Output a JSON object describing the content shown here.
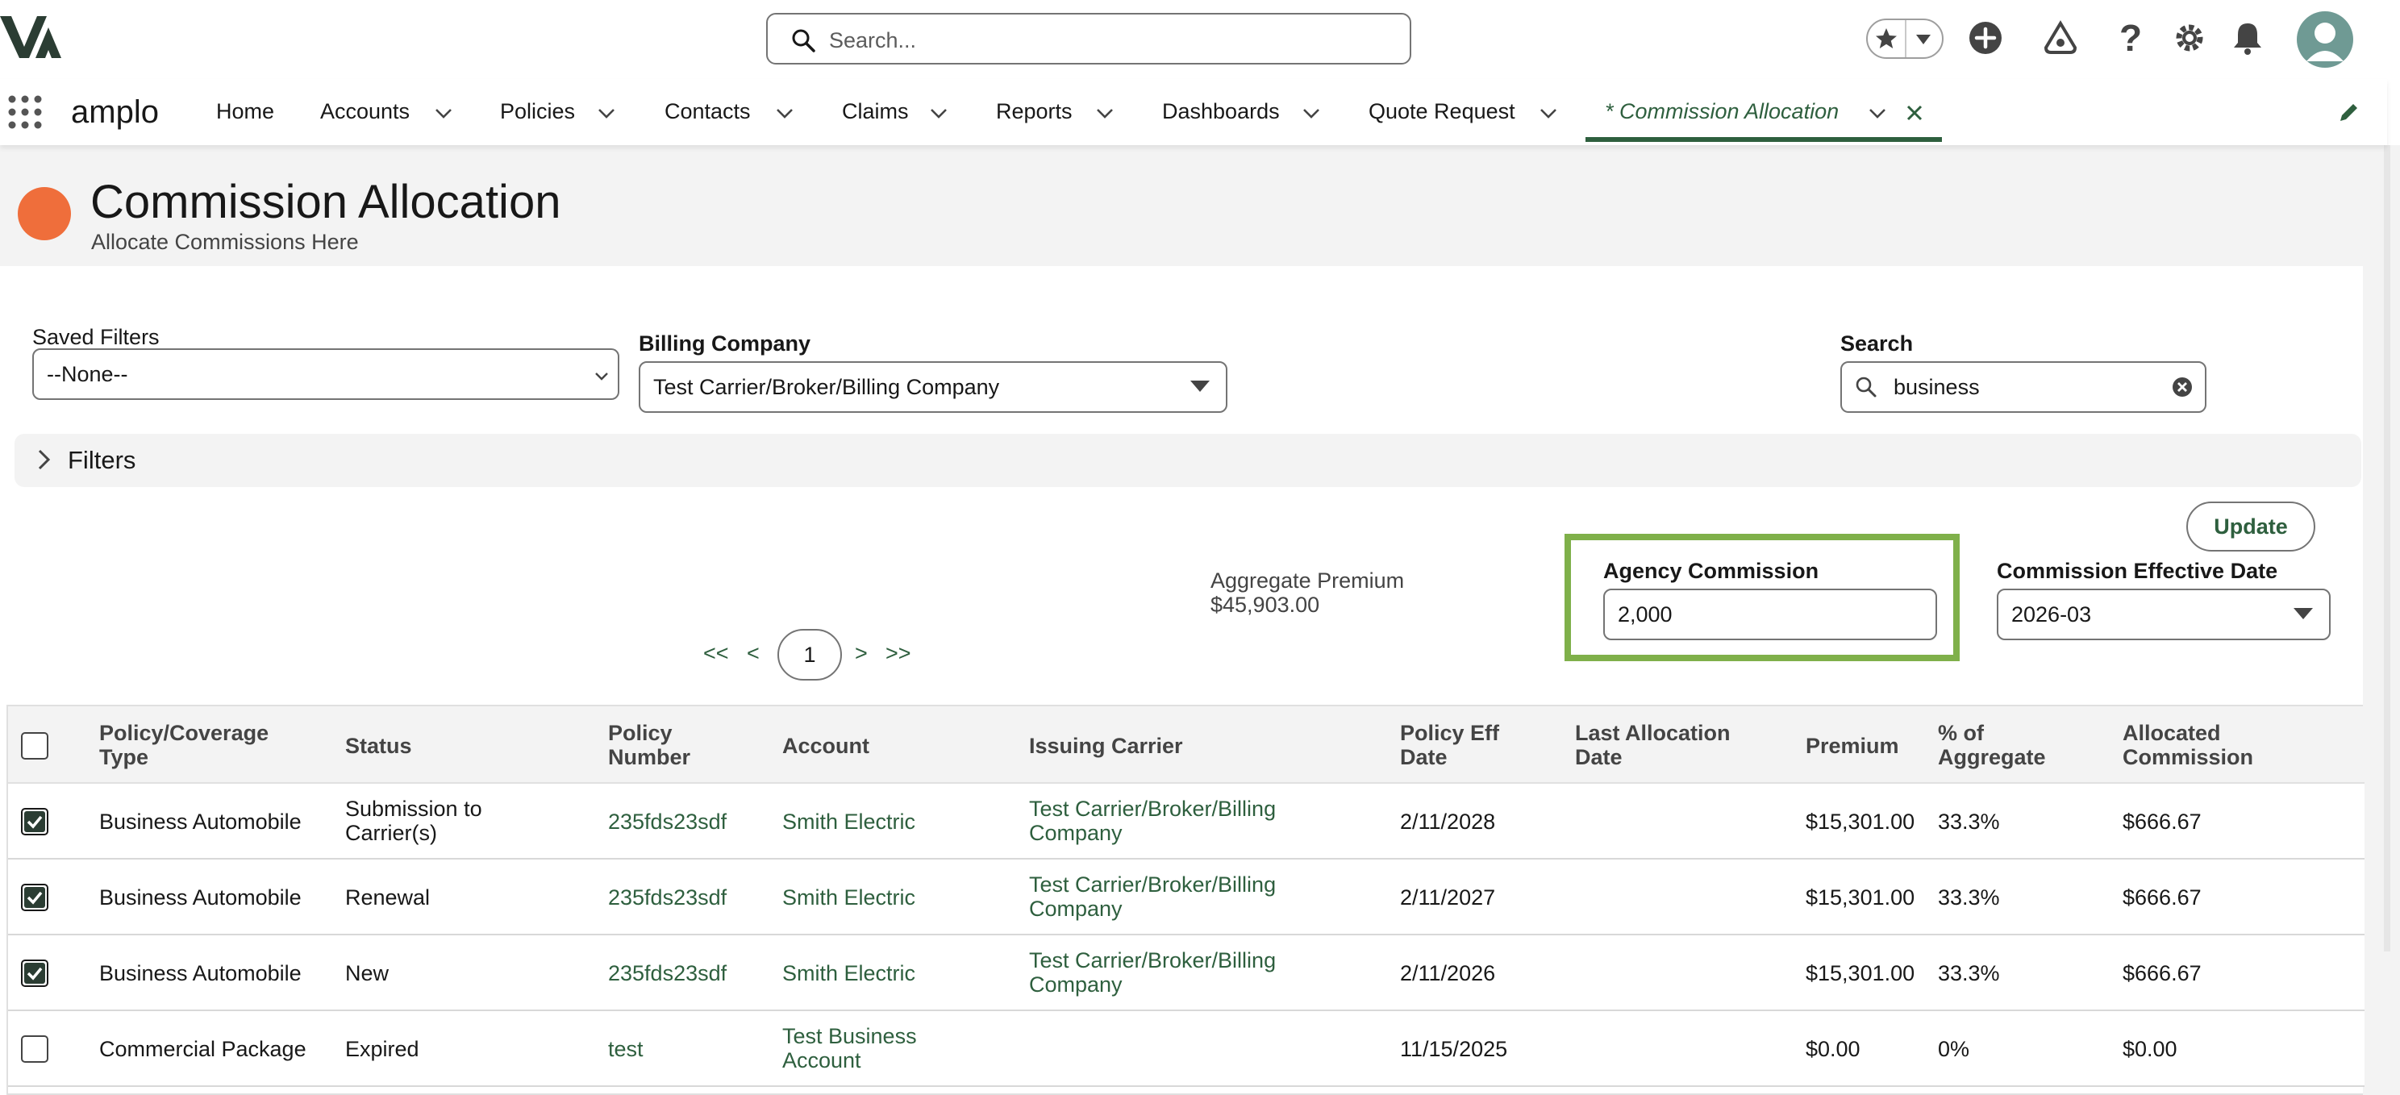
{
  "header": {
    "search_placeholder": "Search..."
  },
  "nav": {
    "app_name": "amplo",
    "items": [
      {
        "label": "Home"
      },
      {
        "label": "Accounts"
      },
      {
        "label": "Policies"
      },
      {
        "label": "Contacts"
      },
      {
        "label": "Claims"
      },
      {
        "label": "Reports"
      },
      {
        "label": "Dashboards"
      },
      {
        "label": "Quote Request"
      }
    ],
    "active_tab": "* Commission Allocation"
  },
  "page": {
    "title": "Commission Allocation",
    "subtitle": "Allocate Commissions Here"
  },
  "filters": {
    "saved_filters_label": "Saved Filters",
    "saved_filters_value": "--None--",
    "billing_company_label": "Billing Company",
    "billing_company_value": "Test Carrier/Broker/Billing Company",
    "search_label": "Search",
    "search_value": "business",
    "filters_toggle": "Filters"
  },
  "summary": {
    "update_label": "Update",
    "aggregate_premium_label": "Aggregate Premium",
    "aggregate_premium_value": "$45,903.00",
    "agency_commission_label": "Agency Commission",
    "agency_commission_value": "2,000",
    "effective_date_label": "Commission Effective Date",
    "effective_date_value": "2026-03"
  },
  "pager": {
    "first": "<<",
    "prev": "<",
    "page": "1",
    "next": ">",
    "last": ">>"
  },
  "table": {
    "headers": {
      "type_1": "Policy/Coverage",
      "type_2": "Type",
      "status": "Status",
      "number_1": "Policy",
      "number_2": "Number",
      "account": "Account",
      "carrier": "Issuing Carrier",
      "eff_1": "Policy Eff",
      "eff_2": "Date",
      "last_1": "Last Allocation",
      "last_2": "Date",
      "premium": "Premium",
      "pct_1": "% of",
      "pct_2": "Aggregate",
      "alloc_1": "Allocated",
      "alloc_2": "Commission"
    },
    "rows": [
      {
        "checked": true,
        "type": "Business Automobile",
        "status_1": "Submission to",
        "status_2": "Carrier(s)",
        "number": "235fds23sdf",
        "account_1": "Smith Electric",
        "account_2": "",
        "carrier_1": "Test Carrier/Broker/Billing",
        "carrier_2": "Company",
        "eff": "2/11/2028",
        "last": "",
        "premium": "$15,301.00",
        "pct": "33.3%",
        "alloc": "$666.67"
      },
      {
        "checked": true,
        "type": "Business Automobile",
        "status_1": "Renewal",
        "status_2": "",
        "number": "235fds23sdf",
        "account_1": "Smith Electric",
        "account_2": "",
        "carrier_1": "Test Carrier/Broker/Billing",
        "carrier_2": "Company",
        "eff": "2/11/2027",
        "last": "",
        "premium": "$15,301.00",
        "pct": "33.3%",
        "alloc": "$666.67"
      },
      {
        "checked": true,
        "type": "Business Automobile",
        "status_1": "New",
        "status_2": "",
        "number": "235fds23sdf",
        "account_1": "Smith Electric",
        "account_2": "",
        "carrier_1": "Test Carrier/Broker/Billing",
        "carrier_2": "Company",
        "eff": "2/11/2026",
        "last": "",
        "premium": "$15,301.00",
        "pct": "33.3%",
        "alloc": "$666.67"
      },
      {
        "checked": false,
        "type": "Commercial Package",
        "status_1": "Expired",
        "status_2": "",
        "number": "test",
        "account_1": "Test Business",
        "account_2": "Account",
        "carrier_1": "",
        "carrier_2": "",
        "eff": "11/15/2025",
        "last": "",
        "premium": "$0.00",
        "pct": "0%",
        "alloc": "$0.00"
      }
    ]
  },
  "colors": {
    "brand_green": "#2e5f3e",
    "highlight_green": "#7fb04a",
    "page_icon": "#ef6e3b"
  }
}
